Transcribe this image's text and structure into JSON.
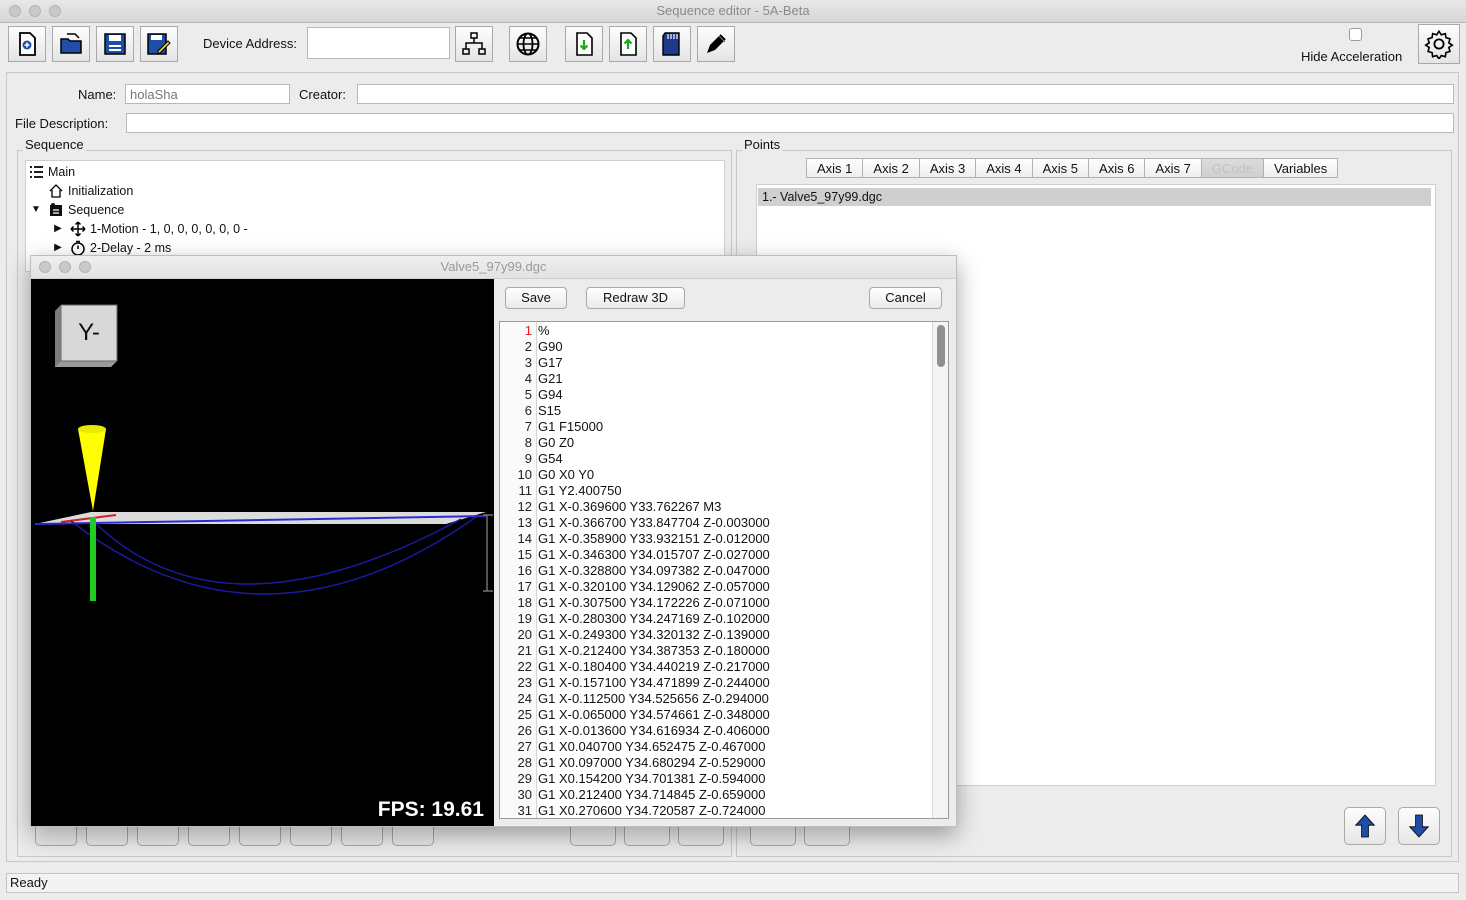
{
  "window": {
    "title": "Sequence editor - 5A-Beta"
  },
  "toolbar": {
    "device_address_label": "Device Address:",
    "device_address_value": "",
    "hide_acceleration_label": "Hide Acceleration",
    "hide_acceleration_checked": false,
    "icons": [
      "new-file-icon",
      "open-file-icon",
      "save-icon",
      "save-as-icon",
      "network-icon",
      "globe-icon",
      "download-icon",
      "upload-icon",
      "sd-card-icon",
      "pen-icon",
      "gear-icon"
    ]
  },
  "form": {
    "name_label": "Name:",
    "name_value": "holaSha",
    "creator_label": "Creator:",
    "creator_value": "",
    "file_description_label": "File Description:",
    "file_description_value": ""
  },
  "sequence_panel": {
    "title": "Sequence",
    "tree": [
      {
        "label": "Main",
        "icon": "list-icon"
      },
      {
        "label": "Initialization",
        "icon": "home-icon"
      },
      {
        "label": "Sequence",
        "icon": "sequence-icon"
      },
      {
        "label": "1-Motion - 1, 0, 0, 0, 0, 0, 0 -",
        "icon": "move-icon"
      },
      {
        "label": "2-Delay - 2 ms",
        "icon": "clock-icon"
      }
    ]
  },
  "points_panel": {
    "title": "Points",
    "tabs": [
      "Axis 1",
      "Axis 2",
      "Axis 3",
      "Axis 4",
      "Axis 5",
      "Axis 6",
      "Axis 7",
      "GCode",
      "Variables"
    ],
    "selected_item": "1.- Valve5_97y99.dgc"
  },
  "dialog": {
    "title": "Valve5_97y99.dgc",
    "save_label": "Save",
    "redraw_label": "Redraw 3D",
    "cancel_label": "Cancel",
    "view_cube_label": "Y-",
    "fps": "FPS: 19.61",
    "code_lines": [
      "%",
      "G90",
      "G17",
      "G21",
      "G94",
      "S15",
      "G1 F15000",
      "G0 Z0",
      "G54",
      "G0 X0 Y0",
      "G1 Y2.400750",
      "G1 X-0.369600 Y33.762267 M3",
      "G1 X-0.366700 Y33.847704 Z-0.003000",
      "G1 X-0.358900 Y33.932151 Z-0.012000",
      "G1 X-0.346300 Y34.015707 Z-0.027000",
      "G1 X-0.328800 Y34.097382 Z-0.047000",
      "G1 X-0.320100 Y34.129062 Z-0.057000",
      "G1 X-0.307500 Y34.172226 Z-0.071000",
      "G1 X-0.280300 Y34.247169 Z-0.102000",
      "G1 X-0.249300 Y34.320132 Z-0.139000",
      "G1 X-0.212400 Y34.387353 Z-0.180000",
      "G1 X-0.180400 Y34.440219 Z-0.217000",
      "G1 X-0.157100 Y34.471899 Z-0.244000",
      "G1 X-0.112500 Y34.525656 Z-0.294000",
      "G1 X-0.065000 Y34.574661 Z-0.348000",
      "G1 X-0.013600 Y34.616934 Z-0.406000",
      "G1 X0.040700 Y34.652475 Z-0.467000",
      "G1 X0.097000 Y34.680294 Z-0.529000",
      "G1 X0.154200 Y34.701381 Z-0.594000",
      "G1 X0.212400 Y34.714845 Z-0.659000",
      "G1 X0.270600 Y34.720587 Z-0.724000"
    ]
  },
  "status": {
    "text": "Ready"
  },
  "colors": {
    "accent_blue": "#1f4ea8",
    "tool_yellow": "#ffff00",
    "axis_green": "#22cc22",
    "path_blue": "#1a1aa0"
  }
}
